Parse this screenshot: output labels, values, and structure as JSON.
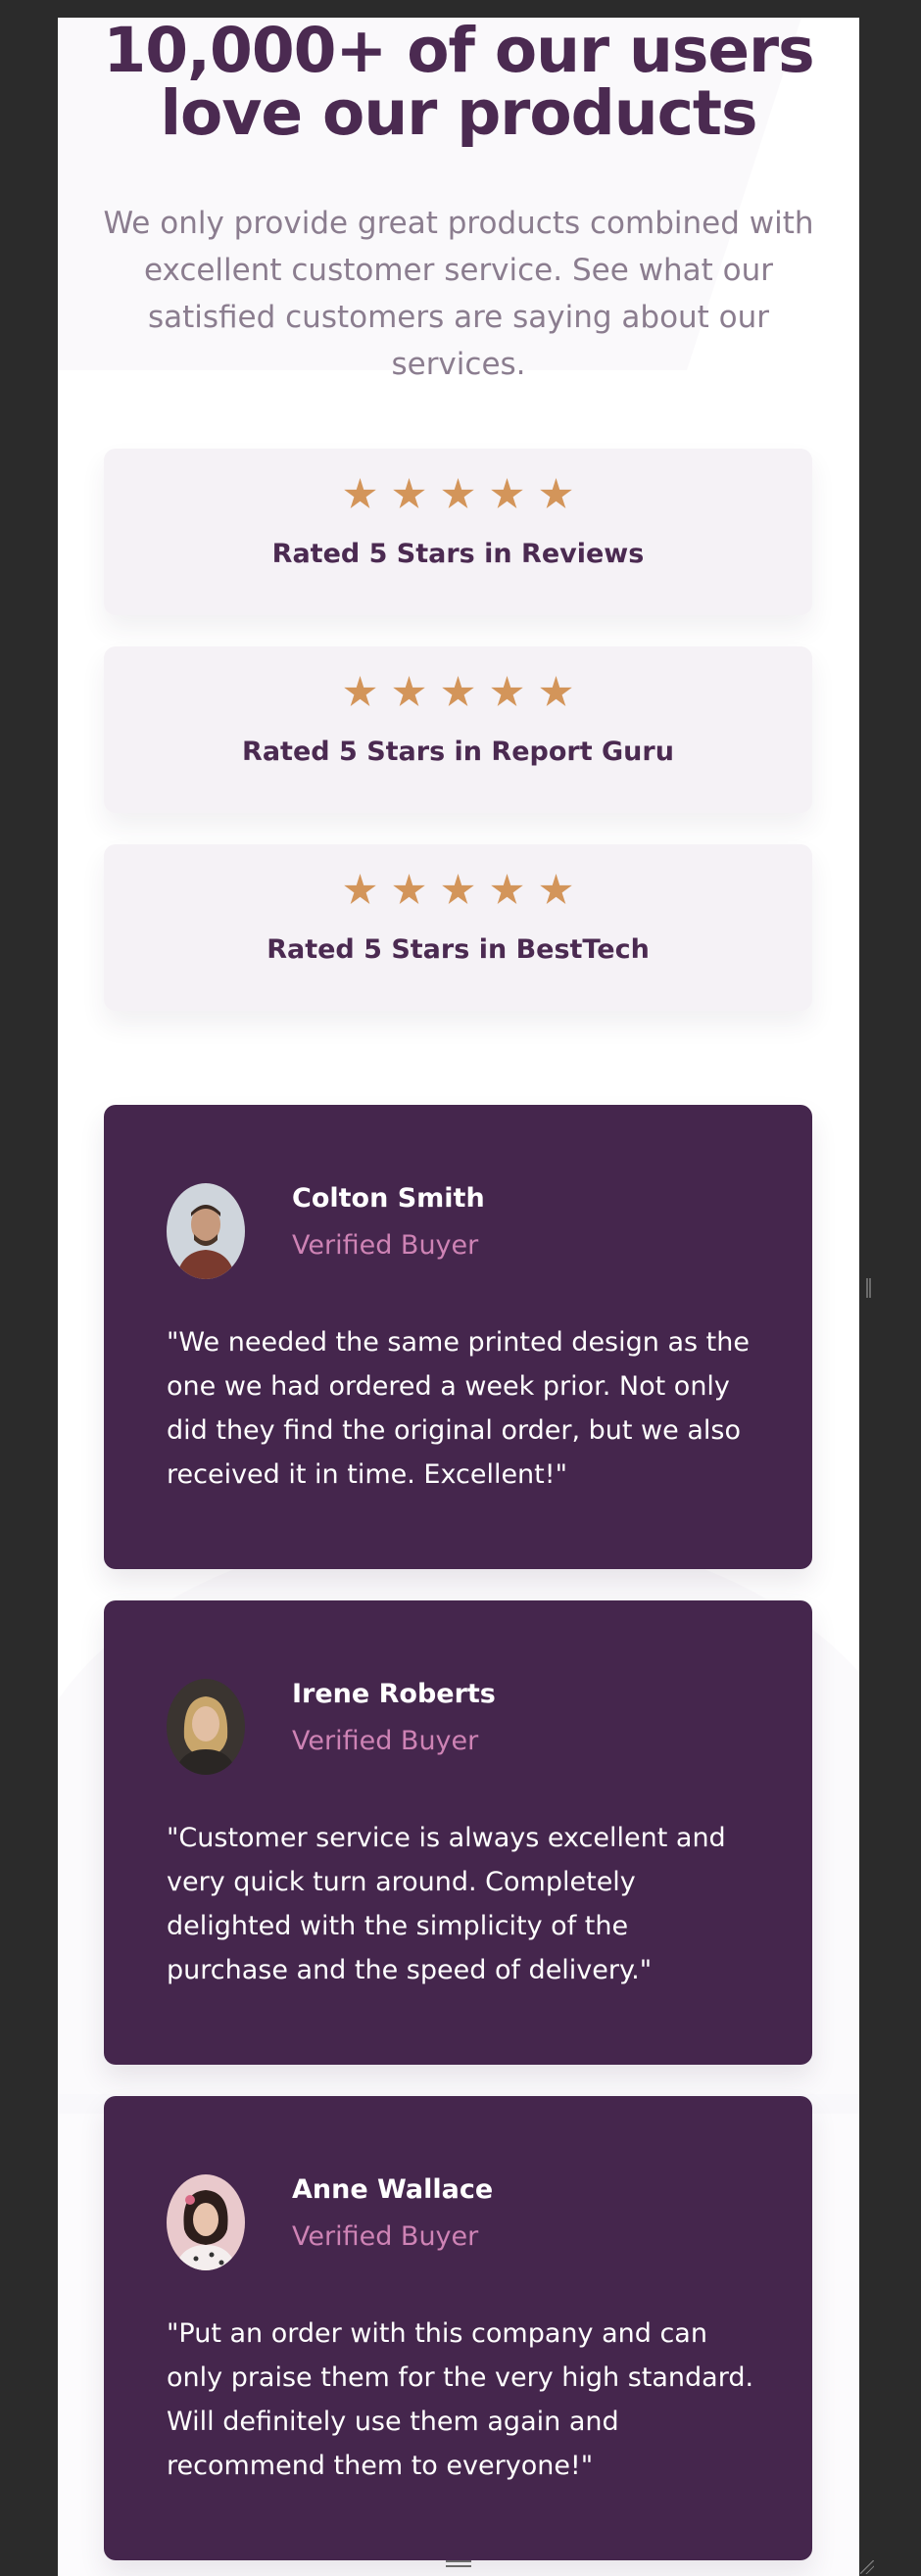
{
  "hero": {
    "title": "10,000+ of our users love our products",
    "subtitle": "We only provide great products combined with excellent customer service. See what our satisfied customers are saying about our services."
  },
  "ratings": [
    {
      "stars": 5,
      "label": "Rated 5 Stars in Reviews"
    },
    {
      "stars": 5,
      "label": "Rated 5 Stars in Report Guru"
    },
    {
      "stars": 5,
      "label": "Rated 5 Stars in BestTech"
    }
  ],
  "testimonials": [
    {
      "name": "Colton Smith",
      "role": "Verified Buyer",
      "quote": "\"We needed the same printed design as the one we had ordered a week prior. Not only did they find the original order, but we also received it in time. Excellent!\""
    },
    {
      "name": "Irene Roberts",
      "role": "Verified Buyer",
      "quote": "\"Customer service is always excellent and very quick turn around. Completely delighted with the simplicity of the purchase and the speed of delivery.\""
    },
    {
      "name": "Anne Wallace",
      "role": "Verified Buyer",
      "quote": "\"Put an order with this company and can only praise them for the very high standard. Will definitely use them again and recommend them to everyone!\""
    }
  ],
  "icons": {
    "star": "star-icon",
    "avatar": "avatar-photo"
  },
  "colors": {
    "heading": "#4b2a51",
    "subtitle": "#8b7d8f",
    "star": "#d3955a",
    "rating_card_bg": "#f5f2f6",
    "testimonial_bg": "#45264d",
    "verified": "#ce83b5",
    "frame": "#2b2b2b"
  }
}
